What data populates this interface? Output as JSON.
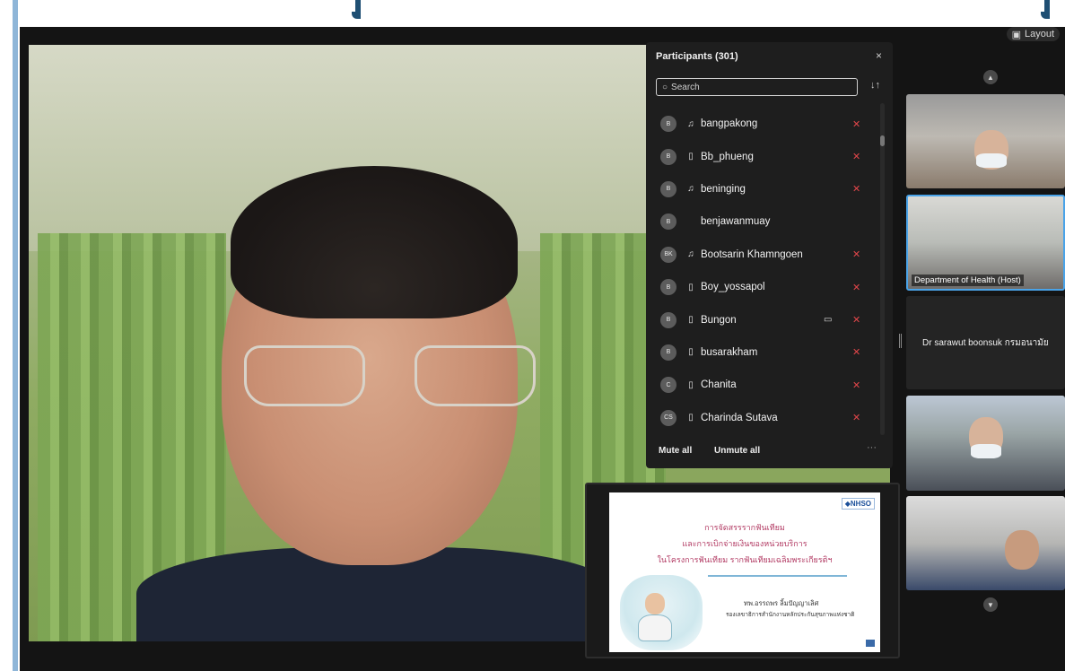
{
  "window": {
    "layout_button_label": "Layout"
  },
  "participants_panel": {
    "title": "Participants (301)",
    "close_glyph": "×",
    "search_placeholder": "Search",
    "sort_glyph": "↓↑",
    "participants": [
      {
        "initials": "B",
        "name": "bangpakong",
        "device": "headset",
        "video_on": false,
        "mic_muted": true
      },
      {
        "initials": "B",
        "name": "Bb_phueng",
        "device": "phone",
        "video_on": false,
        "mic_muted": true
      },
      {
        "initials": "B",
        "name": "beninging",
        "device": "headset",
        "video_on": false,
        "mic_muted": true
      },
      {
        "initials": "B",
        "name": "benjawanmuay",
        "device": "none",
        "video_on": false,
        "mic_muted": false
      },
      {
        "initials": "BK",
        "name": "Bootsarin Khamngoen",
        "device": "headset",
        "video_on": false,
        "mic_muted": true
      },
      {
        "initials": "B",
        "name": "Boy_yossapol",
        "device": "phone",
        "video_on": false,
        "mic_muted": true
      },
      {
        "initials": "B",
        "name": "Bungon",
        "device": "phone",
        "video_on": true,
        "mic_muted": true
      },
      {
        "initials": "B",
        "name": "busarakham",
        "device": "phone",
        "video_on": false,
        "mic_muted": true
      },
      {
        "initials": "C",
        "name": "Chanita",
        "device": "phone",
        "video_on": false,
        "mic_muted": true
      },
      {
        "initials": "CS",
        "name": "Charinda Sutava",
        "device": "phone",
        "video_on": false,
        "mic_muted": true
      }
    ],
    "mute_all_label": "Mute all",
    "unmute_all_label": "Unmute all",
    "more_glyph": "···"
  },
  "video_strip": {
    "host_label": "Department of Health (Host)",
    "participant_name_tile": "Dr sarawut boonsuk กรมอนามัย"
  },
  "shared_slide": {
    "logo": "◆NHSO",
    "line1": "การจัดสรรรากฟันเทียม",
    "line2": "และการเบิกจ่ายเงินของหน่วยบริการ",
    "line3": "ในโครงการฟันเทียม รากฟันเทียมเฉลิมพระเกียรติฯ",
    "presenter": "ทพ.อรรถพร ลิ้มปัญญาเลิศ",
    "presenter_title": "รองเลขาธิการสำนักงานหลักประกันสุขภาพแห่งชาติ"
  },
  "icons": {
    "headset": "♫",
    "phone": "▯",
    "camera": "▭",
    "mic_muted": "✕",
    "search": "○",
    "chevron_up": "▲",
    "chevron_down": "▼",
    "layout": "▣"
  },
  "colors": {
    "accent": "#4aa3e8",
    "muted_red": "#e0464a",
    "panel_bg": "#1e1e1e",
    "frame_blue": "#1f4f73"
  }
}
